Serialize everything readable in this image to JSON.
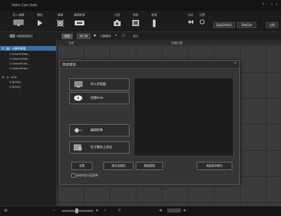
{
  "app": {
    "title": "Video Cam Suite",
    "window_controls": [
      "?",
      "-",
      "□",
      "×"
    ]
  },
  "toolbar": {
    "items": [
      {
        "label": "导入/编辑",
        "icon": "monitor-icon"
      },
      {
        "label": "播放",
        "icon": "play-icon"
      },
      {
        "label": "编辑",
        "icon": "edit-icon"
      },
      {
        "label": "编辑影像",
        "icon": "dvd-icon"
      },
      {
        "label": "光盘",
        "icon": "camera-icon"
      },
      {
        "label": "图像",
        "icon": "film-icon"
      },
      {
        "label": "影像",
        "icon": "phone-icon"
      }
    ],
    "right": {
      "auto_label": "自动",
      "settings_label": "设置"
    },
    "buttons": [
      "高级菜单模式",
      "简单菜单",
      "设置"
    ]
  },
  "modebar": {
    "mode_label": "电脑磁盘模式",
    "tabs": [
      "视图",
      "按日期",
      "日期顺序",
      "显示"
    ]
  },
  "columns": [
    "名称",
    "拍摄日期"
  ],
  "tree": {
    "root": "计算机磁盘",
    "items": [
      "C:\\Users\\Visita...",
      "C:\\Users\\Visita...",
      "C:\\Users\\Publi...",
      "C:\\Users\\Publi..."
    ],
    "dvd_root": "DVD",
    "dvd_items": [
      "E:\\[DVD]",
      "E:\\[DVD]"
    ]
  },
  "dialog": {
    "title": "简单菜单",
    "close": "×",
    "buttons": [
      {
        "label": "导入到电脑",
        "icon": "import-icon"
      },
      {
        "label": "创建DVD",
        "icon": "disc-icon"
      },
      {
        "label": "编辑影像",
        "icon": "edit-video-icon"
      },
      {
        "label": "在计算机上浏览",
        "icon": "browse-icon"
      }
    ],
    "bottom_buttons": [
      "设置",
      "格式化相机",
      "数据管理",
      "高级菜单模式"
    ],
    "startup_checkbox": {
      "label": "启动时显示此菜单",
      "checked": false
    }
  },
  "colors": {
    "accent": "#3a6ea5",
    "background": "#262626",
    "dialog": "#353535"
  }
}
